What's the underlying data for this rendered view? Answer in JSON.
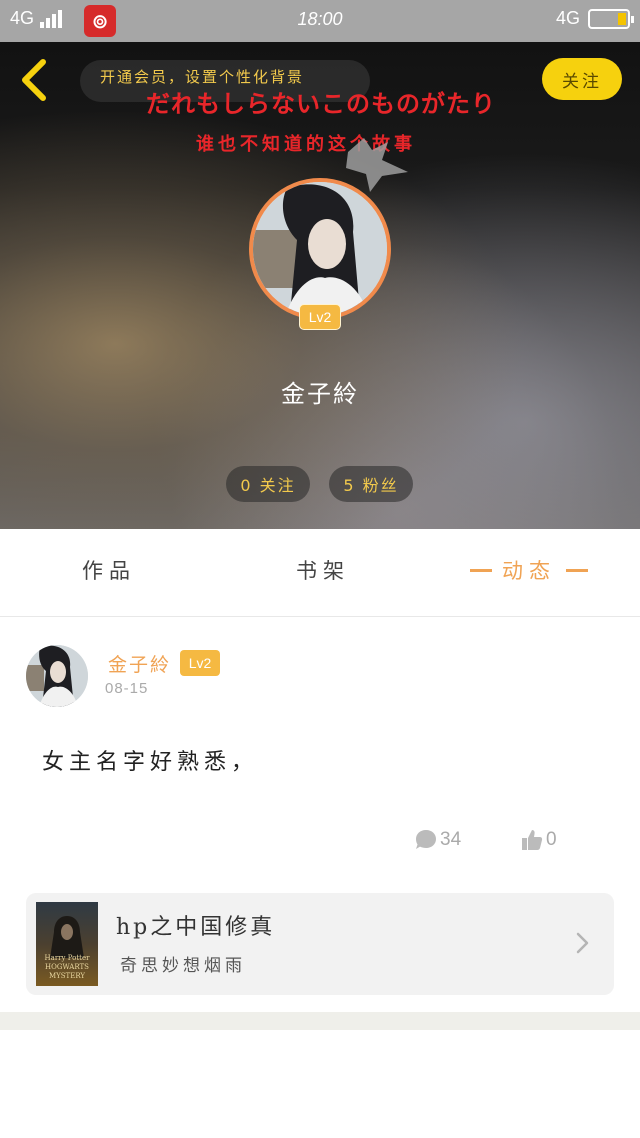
{
  "status_bar": {
    "network_left": "4G",
    "time": "18:00",
    "network_right": "4G",
    "app_icon": "netease-music-icon"
  },
  "header": {
    "back_icon": "chevron-left-icon",
    "banner_text": "开通会员，设置个性化背景",
    "jp_title": "だれもしらないこのものがたり",
    "cn_subtitle": "谁也不知道的这个故事",
    "follow_label": "关注",
    "level": "Lv2",
    "username": "金子紷",
    "stats": {
      "following": "0 关注",
      "fans": "5 粉丝"
    }
  },
  "tabs": [
    {
      "label": "作品"
    },
    {
      "label": "书架"
    },
    {
      "label": "动态",
      "active": true
    }
  ],
  "post": {
    "author": "金子紷",
    "level": "Lv2",
    "date": "08-15",
    "content": "女主名字好熟悉，",
    "comments": "34",
    "likes": "0"
  },
  "book": {
    "title": "hp之中国修真",
    "author": "奇思妙想烟雨",
    "cover_text_1": "Harry Potter",
    "cover_text_2": "HOGWARTS",
    "cover_text_3": "MYSTERY"
  },
  "colors": {
    "accent": "#f0a354",
    "follow_button": "#f6d10e",
    "badge": "#f5b942",
    "red_text": "#e8262a"
  }
}
